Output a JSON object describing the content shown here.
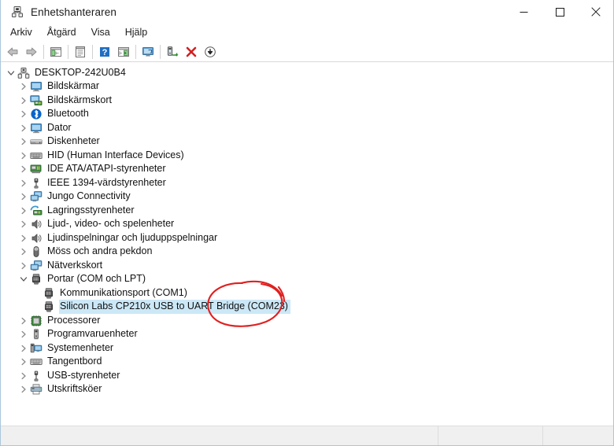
{
  "window": {
    "title": "Enhetshanteraren",
    "title_icon": "device-manager-icon",
    "controls": {
      "minimize": "minimize-button",
      "maximize": "maximize-button",
      "close": "close-button"
    }
  },
  "menubar": {
    "items": [
      {
        "label": "Arkiv"
      },
      {
        "label": "Åtgärd"
      },
      {
        "label": "Visa"
      },
      {
        "label": "Hjälp"
      }
    ]
  },
  "toolbar": {
    "buttons": [
      {
        "name": "back-arrow-icon",
        "title": "Bakåt"
      },
      {
        "name": "forward-arrow-icon",
        "title": "Framåt"
      },
      {
        "name": "show-hide-console-tree-icon",
        "title": "Visa/dölj konsolträd"
      },
      {
        "name": "properties-icon",
        "title": "Egenskaper"
      },
      {
        "name": "help-icon",
        "title": "Hjälp"
      },
      {
        "name": "update-driver-icon",
        "title": "Uppdatera drivrutin"
      },
      {
        "name": "scan-hardware-changes-icon",
        "title": "Sök efter maskinvaruändringar"
      },
      {
        "name": "uninstall-device-icon",
        "title": "Avinstallera enhet"
      },
      {
        "name": "disable-device-icon",
        "title": "Inaktivera enhet"
      },
      {
        "name": "enable-device-icon",
        "title": "Aktivera enhet"
      }
    ]
  },
  "tree": {
    "root": {
      "label": "DESKTOP-242U0B4",
      "icon": "computer-root-icon",
      "expanded": true,
      "level": 0
    },
    "items": [
      {
        "label": "Bildskärmar",
        "icon": "monitor-icon",
        "level": 1,
        "expanded": false,
        "selected": false
      },
      {
        "label": "Bildskärmskort",
        "icon": "display-adapter-icon",
        "level": 1,
        "expanded": false,
        "selected": false
      },
      {
        "label": "Bluetooth",
        "icon": "bluetooth-icon",
        "level": 1,
        "expanded": false,
        "selected": false
      },
      {
        "label": "Dator",
        "icon": "computer-icon",
        "level": 1,
        "expanded": false,
        "selected": false
      },
      {
        "label": "Diskenheter",
        "icon": "disk-drive-icon",
        "level": 1,
        "expanded": false,
        "selected": false
      },
      {
        "label": "HID (Human Interface Devices)",
        "icon": "hid-icon",
        "level": 1,
        "expanded": false,
        "selected": false
      },
      {
        "label": "IDE ATA/ATAPI-styrenheter",
        "icon": "ide-controller-icon",
        "level": 1,
        "expanded": false,
        "selected": false
      },
      {
        "label": "IEEE 1394-värdstyrenheter",
        "icon": "ieee1394-icon",
        "level": 1,
        "expanded": false,
        "selected": false
      },
      {
        "label": "Jungo Connectivity",
        "icon": "network-stack-icon",
        "level": 1,
        "expanded": false,
        "selected": false
      },
      {
        "label": "Lagringsstyrenheter",
        "icon": "storage-controller-icon",
        "level": 1,
        "expanded": false,
        "selected": false
      },
      {
        "label": "Ljud-, video- och spelenheter",
        "icon": "speaker-icon",
        "level": 1,
        "expanded": false,
        "selected": false
      },
      {
        "label": "Ljudinspelningar och ljuduppspelningar",
        "icon": "speaker-icon",
        "level": 1,
        "expanded": false,
        "selected": false
      },
      {
        "label": "Möss och andra pekdon",
        "icon": "mouse-icon",
        "level": 1,
        "expanded": false,
        "selected": false
      },
      {
        "label": "Nätverkskort",
        "icon": "network-adapter-icon",
        "level": 1,
        "expanded": false,
        "selected": false
      },
      {
        "label": "Portar (COM och LPT)",
        "icon": "port-icon",
        "level": 1,
        "expanded": true,
        "selected": false
      },
      {
        "label": "Kommunikationsport (COM1)",
        "icon": "port-icon",
        "level": 2,
        "expanded": null,
        "selected": false
      },
      {
        "label": "Silicon Labs CP210x USB to UART Bridge (COM23)",
        "icon": "port-icon",
        "level": 2,
        "expanded": null,
        "selected": true
      },
      {
        "label": "Processorer",
        "icon": "processor-icon",
        "level": 1,
        "expanded": false,
        "selected": false
      },
      {
        "label": "Programvaruenheter",
        "icon": "software-device-icon",
        "level": 1,
        "expanded": false,
        "selected": false
      },
      {
        "label": "Systemenheter",
        "icon": "system-device-icon",
        "level": 1,
        "expanded": false,
        "selected": false
      },
      {
        "label": "Tangentbord",
        "icon": "keyboard-icon",
        "level": 1,
        "expanded": false,
        "selected": false
      },
      {
        "label": "USB-styrenheter",
        "icon": "usb-icon",
        "level": 1,
        "expanded": false,
        "selected": false
      },
      {
        "label": "Utskriftsköer",
        "icon": "printer-icon",
        "level": 1,
        "expanded": false,
        "selected": false
      }
    ]
  },
  "statusbar": {
    "panes": [
      "",
      "",
      ""
    ]
  },
  "annotation": {
    "shape": "hand-drawn-circle",
    "color": "#e02020",
    "targets": "Silicon Labs CP210x USB to UART Bridge (COM23)"
  },
  "colors": {
    "selection": "#cce8f7",
    "window_border": "#a9c6d9",
    "statusbar": "#f0f0f0",
    "text": "#111111",
    "annotation_red": "#e02020"
  }
}
